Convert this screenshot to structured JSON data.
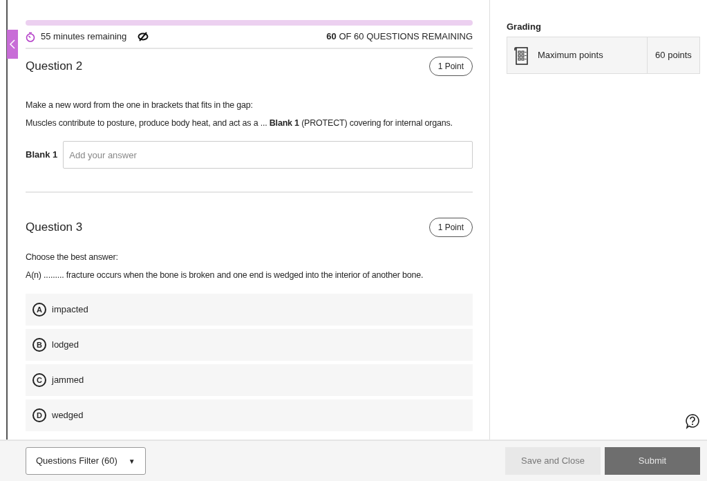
{
  "timer": {
    "text": "55 minutes remaining"
  },
  "progress_text": "**60** OF 60 QUESTIONS REMAINING",
  "questions": [
    {
      "kind": "fill",
      "title": "Question 2",
      "points": "1 Point",
      "prompt": [
        "Make a new word from the one in brackets that fits in the gap:",
        "Muscles contribute to posture, produce body heat, and act as a ... **Blank 1** (PROTECT) covering for internal organs."
      ],
      "blank_label": "Blank 1",
      "placeholder": "Add your answer"
    },
    {
      "kind": "choice",
      "title": "Question 3",
      "points": "1 Point",
      "prompt": [
        "Choose the best answer:",
        "A(n) ......... fracture occurs when the bone is broken and one end is wedged into the interior of another bone."
      ],
      "options": [
        {
          "letter": "A",
          "text": "impacted",
          "selected": false
        },
        {
          "letter": "B",
          "text": "lodged",
          "selected": false
        },
        {
          "letter": "C",
          "text": "jammed",
          "selected": false
        },
        {
          "letter": "D",
          "text": "wedged",
          "selected": false
        }
      ]
    }
  ],
  "grading": {
    "title": "Grading",
    "label": "Maximum points",
    "value": "60 points"
  },
  "footer": {
    "filter": "Questions Filter (60)",
    "filter_caret": "▼",
    "save": "Save and Close",
    "submit": "Submit"
  }
}
